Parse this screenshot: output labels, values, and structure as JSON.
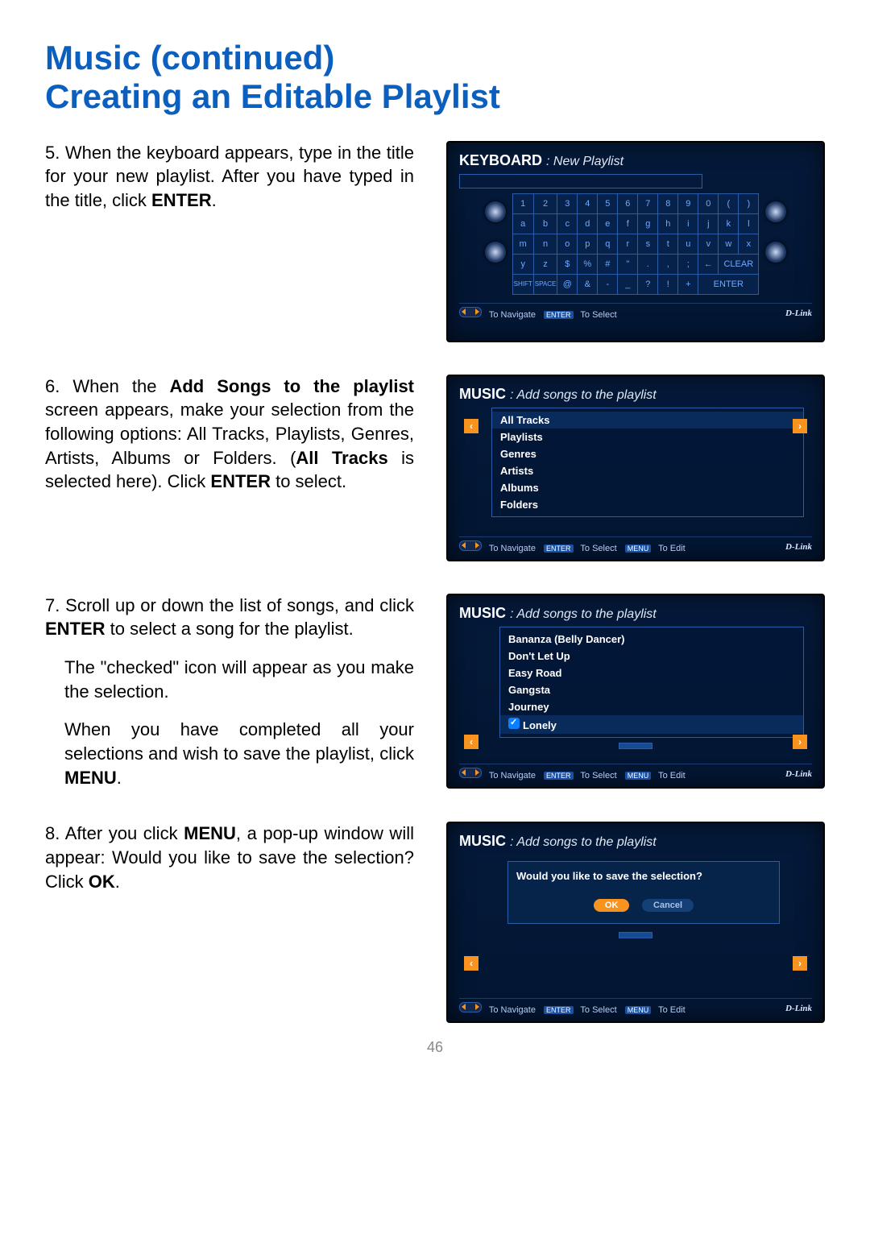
{
  "heading_line1": "Music (continued)",
  "heading_line2": "Creating an Editable Playlist",
  "steps": {
    "s5": {
      "num": "5.",
      "pre": "When the keyboard appears, type in the title for your new playlist. After you have typed in the title, click ",
      "bold": "ENTER",
      "post": "."
    },
    "s6": {
      "num": "6.",
      "pre": "When the ",
      "bold1": "Add Songs to the playlist",
      "mid": " screen appears, make your selection from the following options: All Tracks, Playlists, Genres, Artists, Albums or Folders. (",
      "bold2": "All Tracks",
      "mid2": " is selected here). Click ",
      "bold3": "ENTER",
      "post": " to select."
    },
    "s7": {
      "num": "7.",
      "p1_pre": "Scroll up or down the list of songs, and click ",
      "p1_b": "ENTER",
      "p1_post": " to select a song for the playlist.",
      "p2": "The \"checked\" icon will appear as you make the selection.",
      "p3_pre": "When you have completed all your selections and wish to save the playlist, click ",
      "p3_b": "MENU",
      "p3_post": "."
    },
    "s8": {
      "num": "8.",
      "pre": "After you click ",
      "bold1": "MENU",
      "mid": ", a pop-up window will appear: Would you like to save the selection? Click ",
      "bold2": "OK",
      "post": "."
    }
  },
  "screens": {
    "kb": {
      "title": "KEYBOARD",
      "label": ": New Playlist",
      "rows": [
        [
          "1",
          "2",
          "3",
          "4",
          "5",
          "6",
          "7",
          "8",
          "9",
          "0",
          "(",
          ")"
        ],
        [
          "a",
          "b",
          "c",
          "d",
          "e",
          "f",
          "g",
          "h",
          "i",
          "j",
          "k",
          "l"
        ],
        [
          "m",
          "n",
          "o",
          "p",
          "q",
          "r",
          "s",
          "t",
          "u",
          "v",
          "w",
          "x"
        ],
        [
          "y",
          "z",
          "$",
          "%",
          "#",
          "\"",
          ".",
          ",",
          ";",
          "←",
          "CLEAR",
          ""
        ],
        [
          "SHIFT",
          "SPACE",
          "@",
          "&",
          "-",
          "_",
          "?",
          "!",
          "+",
          "ENTER",
          "",
          ""
        ]
      ],
      "nav": "To Navigate",
      "sel": "To Select",
      "brand": "D-Link"
    },
    "add1": {
      "title": "MUSIC",
      "label": ": Add songs to the playlist",
      "items": [
        "All Tracks",
        "Playlists",
        "Genres",
        "Artists",
        "Albums",
        "Folders"
      ],
      "selectedIndex": 0,
      "nav": "To Navigate",
      "sel": "To Select",
      "edit": "To Edit",
      "brand": "D-Link"
    },
    "add2": {
      "title": "MUSIC",
      "label": ": Add songs to the playlist",
      "items": [
        "Bananza (Belly Dancer)",
        "Don't Let Up",
        "Easy Road",
        "Gangsta",
        "Journey",
        "Lonely"
      ],
      "checkedIndex": 5,
      "nav": "To Navigate",
      "sel": "To Select",
      "edit": "To Edit",
      "brand": "D-Link"
    },
    "save": {
      "title": "MUSIC",
      "label": ": Add songs to the playlist",
      "question": "Would you like to save the selection?",
      "ok": "OK",
      "cancel": "Cancel",
      "nav": "To Navigate",
      "sel": "To Select",
      "edit": "To Edit",
      "brand": "D-Link"
    }
  },
  "page_number": "46"
}
